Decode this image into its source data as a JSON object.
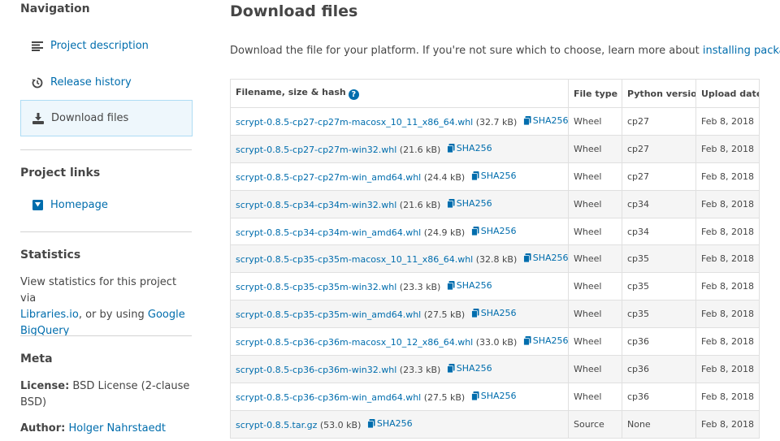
{
  "sidebar": {
    "nav_title": "Navigation",
    "nav_items": [
      {
        "label": "Project description",
        "icon": "align-left-icon"
      },
      {
        "label": "Release history",
        "icon": "history-icon"
      },
      {
        "label": "Download files",
        "icon": "download-icon"
      }
    ],
    "links_title": "Project links",
    "homepage_label": "Homepage",
    "stats_title": "Statistics",
    "stats_text_1": "View statistics for this project via",
    "stats_link_1": "Libraries.io",
    "stats_text_2": ", or by using ",
    "stats_link_2a": "Google",
    "stats_link_2b": "BigQuery",
    "meta_title": "Meta",
    "license_label": "License:",
    "license_value_1": " BSD License (2-clause",
    "license_value_2": "BSD)",
    "author_label": "Author:",
    "author_value": "Holger Nahrstaedt"
  },
  "main": {
    "title": "Download files",
    "intro_text": "Download the file for your platform. If you're not sure which to choose, learn more about ",
    "intro_link": "installing packages",
    "intro_end": ".",
    "columns": [
      "Filename, size & hash",
      "File type",
      "Python version",
      "Upload date"
    ],
    "sha_label": "SHA256",
    "rows": [
      {
        "name": "scrypt-0.8.5-cp27-cp27m-macosx_10_11_x86_64.whl",
        "size": "(32.7 kB)",
        "type": "Wheel",
        "py": "cp27",
        "date": "Feb 8, 2018"
      },
      {
        "name": "scrypt-0.8.5-cp27-cp27m-win32.whl",
        "size": "(21.6 kB)",
        "type": "Wheel",
        "py": "cp27",
        "date": "Feb 8, 2018"
      },
      {
        "name": "scrypt-0.8.5-cp27-cp27m-win_amd64.whl",
        "size": "(24.4 kB)",
        "type": "Wheel",
        "py": "cp27",
        "date": "Feb 8, 2018"
      },
      {
        "name": "scrypt-0.8.5-cp34-cp34m-win32.whl",
        "size": "(21.6 kB)",
        "type": "Wheel",
        "py": "cp34",
        "date": "Feb 8, 2018"
      },
      {
        "name": "scrypt-0.8.5-cp34-cp34m-win_amd64.whl",
        "size": "(24.9 kB)",
        "type": "Wheel",
        "py": "cp34",
        "date": "Feb 8, 2018"
      },
      {
        "name": "scrypt-0.8.5-cp35-cp35m-macosx_10_11_x86_64.whl",
        "size": "(32.8 kB)",
        "type": "Wheel",
        "py": "cp35",
        "date": "Feb 8, 2018"
      },
      {
        "name": "scrypt-0.8.5-cp35-cp35m-win32.whl",
        "size": "(23.3 kB)",
        "type": "Wheel",
        "py": "cp35",
        "date": "Feb 8, 2018"
      },
      {
        "name": "scrypt-0.8.5-cp35-cp35m-win_amd64.whl",
        "size": "(27.5 kB)",
        "type": "Wheel",
        "py": "cp35",
        "date": "Feb 8, 2018"
      },
      {
        "name": "scrypt-0.8.5-cp36-cp36m-macosx_10_12_x86_64.whl",
        "size": "(33.0 kB)",
        "type": "Wheel",
        "py": "cp36",
        "date": "Feb 8, 2018"
      },
      {
        "name": "scrypt-0.8.5-cp36-cp36m-win32.whl",
        "size": "(23.3 kB)",
        "type": "Wheel",
        "py": "cp36",
        "date": "Feb 8, 2018"
      },
      {
        "name": "scrypt-0.8.5-cp36-cp36m-win_amd64.whl",
        "size": "(27.5 kB)",
        "type": "Wheel",
        "py": "cp36",
        "date": "Feb 8, 2018"
      },
      {
        "name": "scrypt-0.8.5.tar.gz",
        "size": "(53.0 kB)",
        "type": "Source",
        "py": "None",
        "date": "Feb 8, 2018"
      }
    ]
  },
  "colors": {
    "link": "#006dad",
    "active_bg": "#eef7fc",
    "active_border": "#aedcf4"
  }
}
